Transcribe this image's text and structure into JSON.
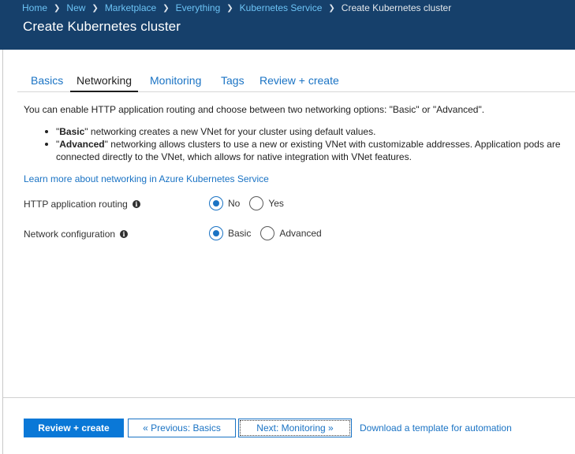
{
  "breadcrumb": {
    "items": [
      "Home",
      "New",
      "Marketplace",
      "Everything",
      "Kubernetes Service"
    ],
    "current": "Create Kubernetes cluster"
  },
  "page_title": "Create Kubernetes cluster",
  "tabs": [
    "Basics",
    "Networking",
    "Monitoring",
    "Tags",
    "Review + create"
  ],
  "active_tab": "Networking",
  "intro": "You can enable HTTP application routing and choose between two networking options: \"Basic\" or \"Advanced\".",
  "bullets": [
    {
      "term": "Basic",
      "text": " networking creates a new VNet for your cluster using default values."
    },
    {
      "term": "Advanced",
      "text": " networking allows clusters to use a new or existing VNet with customizable addresses. Application pods are connected directly to the VNet, which allows for native integration with VNet features."
    }
  ],
  "learn_more": "Learn more about networking in Azure Kubernetes Service",
  "fields": {
    "http_routing": {
      "label": "HTTP application routing",
      "options": [
        "No",
        "Yes"
      ],
      "selected": "No"
    },
    "network_config": {
      "label": "Network configuration",
      "options": [
        "Basic",
        "Advanced"
      ],
      "selected": "Basic"
    }
  },
  "footer": {
    "review_create": "Review + create",
    "previous": "« Previous: Basics",
    "next": "Next: Monitoring »",
    "download": "Download a template for automation"
  },
  "icons": {
    "info": "info-icon",
    "breadcrumb_separator": "chevron-right-icon"
  },
  "colors": {
    "header_bg": "#16406b",
    "link": "#1a73c4",
    "primary_button": "#0a78d7"
  }
}
